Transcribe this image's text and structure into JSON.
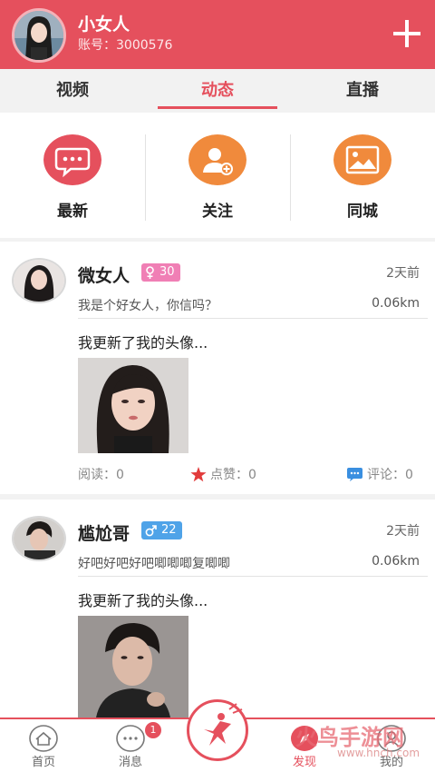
{
  "header": {
    "name": "小女人",
    "account": "账号：3000576"
  },
  "tabs": [
    {
      "label": "视频",
      "active": false
    },
    {
      "label": "动态",
      "active": true
    },
    {
      "label": "直播",
      "active": false
    }
  ],
  "categories": [
    {
      "label": "最新",
      "icon": "chat-bubble-icon",
      "color": "#e5505d"
    },
    {
      "label": "关注",
      "icon": "add-user-icon",
      "color": "#f08a3c"
    },
    {
      "label": "同城",
      "icon": "landscape-icon",
      "color": "#f08a3c"
    }
  ],
  "posts": [
    {
      "name": "微女人",
      "gender": "female",
      "age": "30",
      "badge_color": "#f07fb5",
      "time": "2天前",
      "signature": "我是个好女人，你信吗？",
      "distance": "0.06km",
      "content": "我更新了我的头像...",
      "reads": "阅读：0",
      "likes": "点赞：0",
      "comments": "评论：0"
    },
    {
      "name": "尴尬哥",
      "gender": "male",
      "age": "22",
      "badge_color": "#4fa3e8",
      "time": "2天前",
      "signature": "好吧好吧好吧唧唧唧复唧唧",
      "distance": "0.06km",
      "content": "我更新了我的头像..."
    }
  ],
  "nav": {
    "home": "首页",
    "messages": "消息",
    "message_count": "1",
    "discover": "发现",
    "mine": "我的"
  },
  "watermark": {
    "brand": "火鸟手游网",
    "url": "www.hnch.com"
  },
  "colors": {
    "accent": "#e5505d",
    "orange": "#f08a3c",
    "male": "#4fa3e8",
    "female": "#f07fb5"
  }
}
